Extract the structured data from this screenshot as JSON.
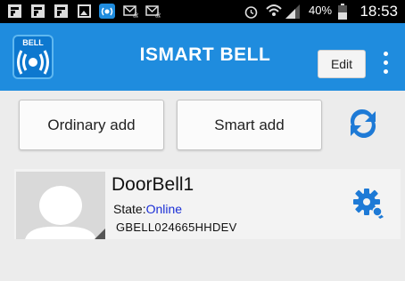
{
  "status_bar": {
    "battery": "40%",
    "time": "18:53",
    "icons": [
      "flipboard-icon",
      "flipboard-icon",
      "flipboard-icon",
      "gallery-icon",
      "bell-app-icon",
      "email-icon",
      "email-icon",
      "alarm-icon",
      "wifi-icon",
      "signal-icon",
      "battery-icon"
    ]
  },
  "app_bar": {
    "logo_text": "BELL",
    "title": "ISMART BELL",
    "edit_label": "Edit"
  },
  "actions": {
    "ordinary_add_label": "Ordinary add",
    "smart_add_label": "Smart add"
  },
  "device": {
    "name": "DoorBell1",
    "state_label": "State:",
    "state_value": "Online",
    "device_id": "GBELL024665HHDEV"
  },
  "colors": {
    "app_bar": "#1f8cde",
    "online": "#1b2fd6",
    "icon_blue": "#1e7ad6"
  }
}
